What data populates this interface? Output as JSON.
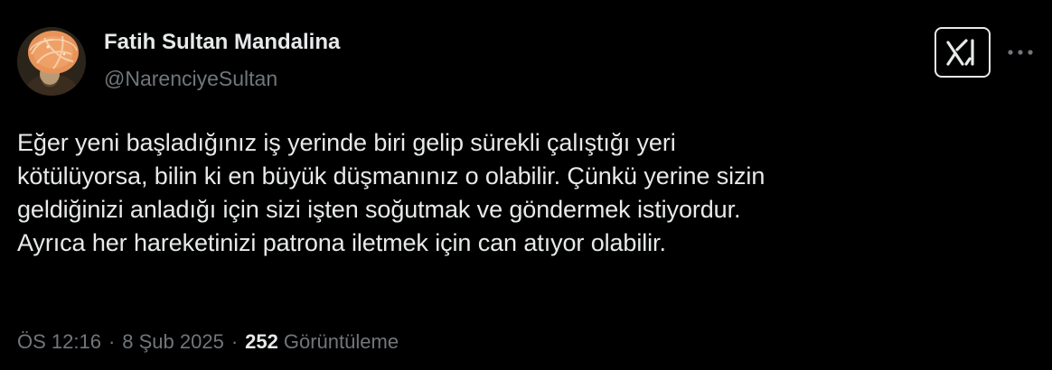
{
  "author": {
    "display_name": "Fatih Sultan Mandalina",
    "handle": "@NarenciyeSultan",
    "avatar_icon": "mandarin-turban-portrait-avatar"
  },
  "actions": {
    "grok_icon": "grok-icon",
    "more_icon": "more-horizontal-icon"
  },
  "tweet": {
    "lines": [
      "Eğer yeni başladığınız iş yerinde biri gelip sürekli çalıştığı yeri",
      "kötülüyorsa, bilin ki en büyük düşmanınız o olabilir. Çünkü yerine sizin",
      "geldiğinizi anladığı için sizi işten soğutmak ve göndermek istiyordur.",
      "Ayrıca her hareketinizi patrona iletmek için can atıyor olabilir."
    ]
  },
  "meta": {
    "time": "ÖS 12:16",
    "separator": "·",
    "date": "8 Şub 2025",
    "views_count": "252",
    "views_label": "Görüntüleme"
  },
  "colors": {
    "background": "#000000",
    "text_primary": "#e7e9ea",
    "text_secondary": "#71767b"
  }
}
